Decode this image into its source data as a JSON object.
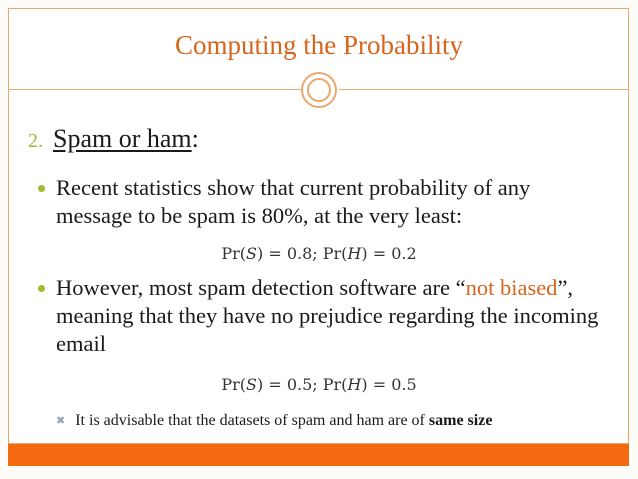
{
  "slide": {
    "title": "Computing the Probability",
    "heading": {
      "number": "2.",
      "text": "Spam or ham",
      "suffix": ":"
    },
    "bullet1": "Recent statistics show that current probability of any message to be spam is 80%, at the very least:",
    "formula1": {
      "pr": "Pr",
      "s": "S",
      "h": "H",
      "s_value": "0.8",
      "h_value": "0.2"
    },
    "bullet2": {
      "before": "However, most spam detection software are “",
      "highlight": "not biased",
      "after": "”, meaning that they have no prejudice regarding the incoming email"
    },
    "formula2": {
      "s_value": "0.5",
      "h_value": "0.5"
    },
    "sub_bullet": {
      "before": "It is advisable that the datasets of spam and ham are of ",
      "bold": "same size"
    }
  },
  "colors": {
    "title": "#d7651b",
    "bullet_dot": "#9bbb2f",
    "accent": "#d7651b",
    "bottom_bar": "#f2690f",
    "frame": "#e9a86d"
  },
  "icons": {
    "bullet": "circle-bullet-icon",
    "sub_bullet": "cross-mark-icon",
    "ornament": "double-circle-icon"
  }
}
